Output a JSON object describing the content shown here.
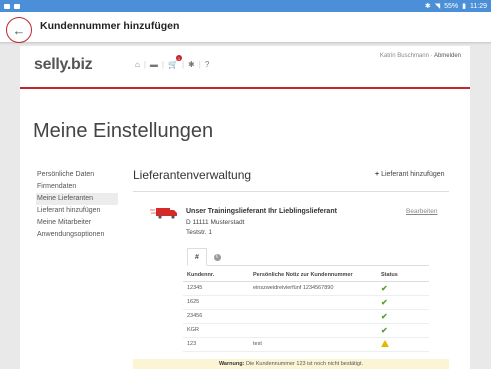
{
  "statusbar": {
    "battery": "55%",
    "time": "11:29"
  },
  "appbar": {
    "title": "Kundennummer hinzufügen"
  },
  "header": {
    "logo": "selly.biz",
    "cart_count": "1",
    "user_name": "Katrin Buschmann",
    "separator": " · ",
    "logout": "Abmelden"
  },
  "page": {
    "heading": "Meine Einstellungen"
  },
  "sidebar": {
    "items": [
      {
        "label": "Persönliche Daten"
      },
      {
        "label": "Firmendaten"
      },
      {
        "label": "Meine Lieferanten"
      },
      {
        "label": "Lieferant hinzufügen"
      },
      {
        "label": "Meine Mitarbeiter"
      },
      {
        "label": "Anwendungsoptionen"
      }
    ]
  },
  "panel": {
    "title": "Lieferantenverwaltung",
    "add_label": "Lieferant hinzufügen"
  },
  "supplier": {
    "name": "Unser Trainingslieferant Ihr Lieblingslieferant",
    "city": "D 11111 Musterstadt",
    "street": "Teststr. 1",
    "edit": "Bearbeiten"
  },
  "tabs": {
    "hash": "#",
    "info": "i"
  },
  "table": {
    "headers": [
      "Kundennr.",
      "Persönliche Notiz zur Kundennummer",
      "Status"
    ],
    "rows": [
      {
        "nr": "12345",
        "note": "einszweidreivierfünf 1234567890",
        "status": "ok"
      },
      {
        "nr": "1625",
        "note": "",
        "status": "ok"
      },
      {
        "nr": "23456",
        "note": "",
        "status": "ok"
      },
      {
        "nr": "KGR",
        "note": "",
        "status": "ok"
      },
      {
        "nr": "123",
        "note": "test",
        "status": "warning"
      }
    ]
  },
  "warning": {
    "label": "Warnung:",
    "text": "Die Kundennummer 123 ist noch nicht bestätigt."
  },
  "colors": {
    "accent": "#c0262f",
    "statusbar": "#4a8fd8",
    "ok": "#5aa02c",
    "warn": "#e6b800"
  }
}
